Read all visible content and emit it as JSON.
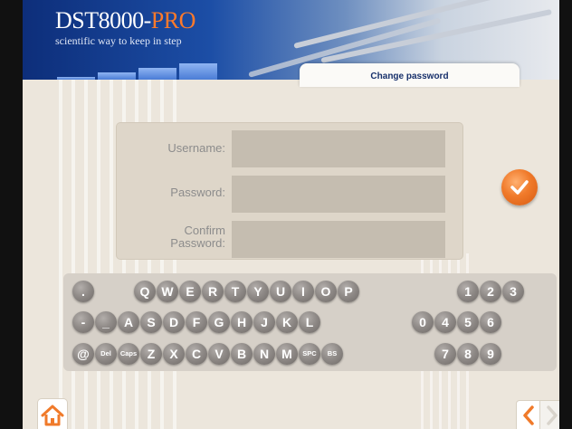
{
  "header": {
    "brand_main": "DST8000-",
    "brand_accent": "PRO",
    "tagline": "scientific way to keep in step",
    "tab_title": "Change password"
  },
  "form": {
    "username_label": "Username:",
    "password_label": "Password:",
    "confirm_label_line1": "Confirm",
    "confirm_label_line2": "Password:",
    "username_value": "",
    "password_value": "",
    "confirm_value": ""
  },
  "keyboard": {
    "row1": [
      ".",
      "Q",
      "W",
      "E",
      "R",
      "T",
      "Y",
      "U",
      "I",
      "O",
      "P",
      "1",
      "2",
      "3"
    ],
    "row2": [
      "-",
      "_",
      "A",
      "S",
      "D",
      "F",
      "G",
      "H",
      "J",
      "K",
      "L",
      "0",
      "4",
      "5",
      "6"
    ],
    "row3": [
      "@",
      "Del",
      "Caps",
      "Z",
      "X",
      "C",
      "V",
      "B",
      "N",
      "M",
      "SPC",
      "BS",
      "7",
      "8",
      "9"
    ]
  },
  "icons": {
    "confirm": "checkmark-icon",
    "home": "home-icon",
    "back": "chevron-left-icon",
    "forward": "chevron-right-icon"
  },
  "colors": {
    "accent": "#f07a2a",
    "banner_dark": "#0d2e7a",
    "key": "#8f8a87"
  }
}
